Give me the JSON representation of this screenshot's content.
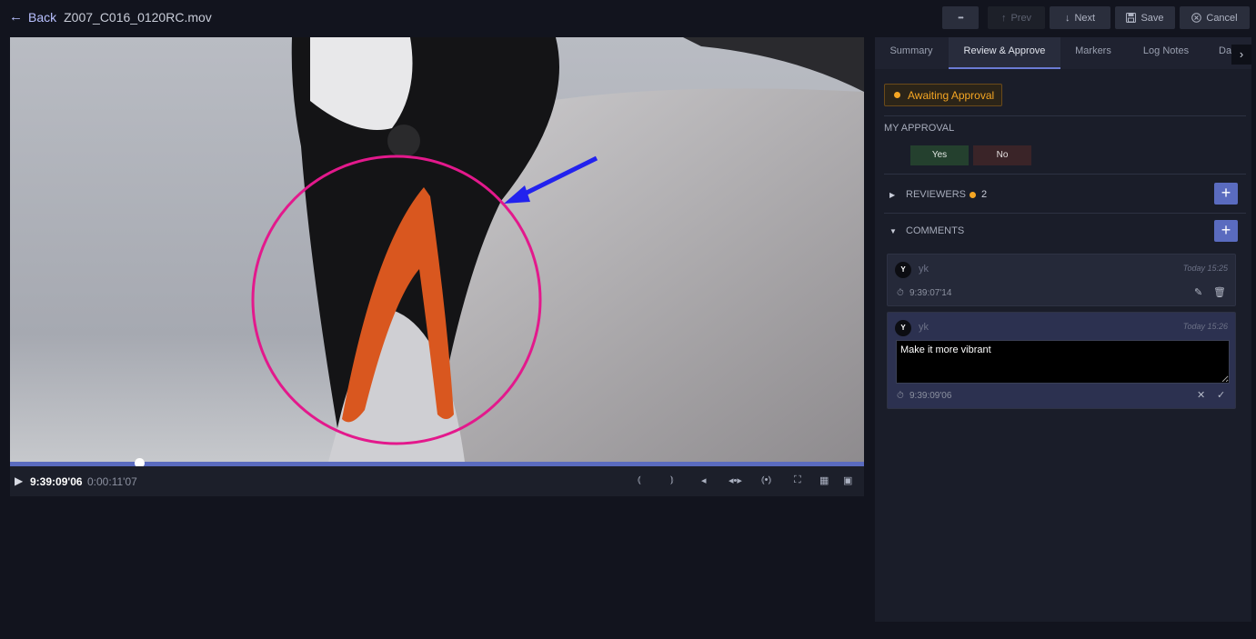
{
  "header": {
    "back_label": "Back",
    "filename": "Z007_C016_0120RC.mov",
    "more_label": "•••",
    "prev_label": "Prev",
    "next_label": "Next",
    "save_label": "Save",
    "cancel_label": "Cancel"
  },
  "player": {
    "timecode": "9:39:09'06",
    "elapsed": "0:00:11'07",
    "progress_fraction": 0.15,
    "annotation_colors": {
      "circle": "#e3198c",
      "arrow": "#2222ee"
    }
  },
  "panel": {
    "tabs": [
      "Summary",
      "Review & Approve",
      "Markers",
      "Log Notes",
      "Da"
    ],
    "active_tab": "Review & Approve",
    "status_label": "Awaiting Approval",
    "my_approval_label": "MY APPROVAL",
    "yes_label": "Yes",
    "no_label": "No",
    "reviewers_label": "REVIEWERS",
    "reviewers_count": "2",
    "comments_label": "COMMENTS",
    "comments": [
      {
        "avatar": "Y",
        "author": "yk",
        "time": "Today 15:25",
        "timecode": "9:39:07'14"
      },
      {
        "avatar": "Y",
        "author": "yk",
        "time": "Today 15:26",
        "timecode": "9:39:09'06",
        "draft": "Make it more vibrant"
      }
    ]
  },
  "colors": {
    "accent": "#5a6bbf",
    "status": "#f5a623",
    "background": "#12141e"
  }
}
